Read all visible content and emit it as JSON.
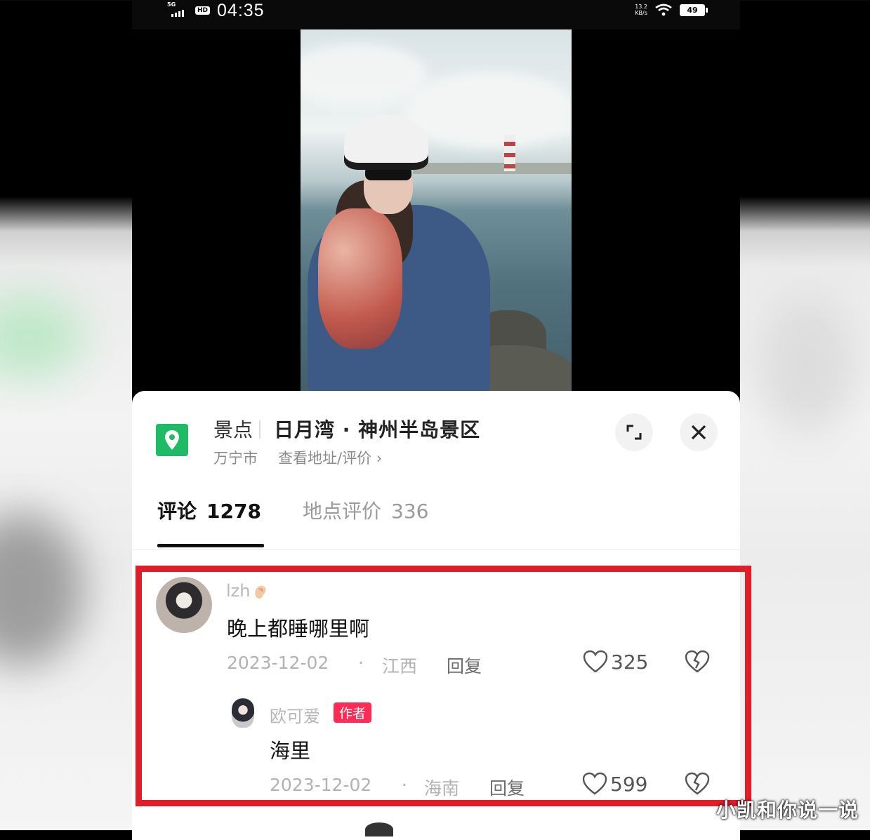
{
  "status_bar": {
    "network": "5G",
    "hd": "HD",
    "time": "04:35",
    "net_speed_value": "13.2",
    "net_speed_unit": "KB/s",
    "battery": "49"
  },
  "location": {
    "category": "景点",
    "name": "日月湾 · 神州半岛景区",
    "city": "万宁市",
    "link": "查看地址/评价 ›",
    "icon": "location-pin-icon"
  },
  "tabs": [
    {
      "label": "评论",
      "count": "1278"
    },
    {
      "label": "地点评价",
      "count": "336"
    }
  ],
  "comments": [
    {
      "user": "lzh",
      "user_emoji": "ear-emoji-icon",
      "text": "晚上都睡哪里啊",
      "date": "2023-12-02",
      "region": "江西",
      "reply_label": "回复",
      "likes": "325"
    },
    {
      "user": "欧可爱",
      "badge": "作者",
      "text": "海里",
      "date": "2023-12-02",
      "region": "海南",
      "reply_label": "回复",
      "likes": "599"
    }
  ],
  "meta_separator": "·",
  "watermark": "小凯和你说一说",
  "colors": {
    "highlight_border": "#e11d27",
    "location_icon": "#1fba65",
    "author_badge": "#fe2c55"
  }
}
